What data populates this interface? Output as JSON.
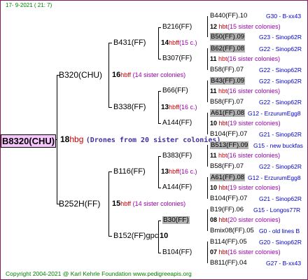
{
  "header": {
    "date": "17-  9-2021 ( 21:  7)"
  },
  "root": {
    "name": "B8320(CHU)",
    "year": "18",
    "hb": "hbg",
    "drones": "(Drones from 20 sister colonies)"
  },
  "g1": [
    {
      "name": "B320(CHU)",
      "year": "16",
      "hb": "hbff",
      "sis": "(14 sister colonies)"
    },
    {
      "name": "B252H(FF)",
      "year": "15",
      "hb": "hbff",
      "sis": "(14 sister colonies)"
    }
  ],
  "g2": [
    {
      "name": "B431(FF)",
      "year": "14",
      "hb": "hbff",
      "sis": "(15 c.)"
    },
    {
      "name": "B338(FF)",
      "year": "13",
      "hb": "hbff",
      "sis": "(16 c.)"
    },
    {
      "name": "B116(FF)",
      "year": "13",
      "hb": "hbff",
      "sis": "(16 c.)"
    },
    {
      "name": "B152(FF)gpc",
      "year": "10"
    }
  ],
  "g3": [
    {
      "name": "B216(FF)",
      "year": "12",
      "hb": "hbt",
      "sis": "(15 sister colonies)"
    },
    {
      "name": "B307(FF)",
      "year": "11",
      "hb": "hbt",
      "sis": "(16 sister colonies)"
    },
    {
      "name": "B66(FF)",
      "year": "11",
      "hb": "hbt",
      "sis": "(16 sister colonies)"
    },
    {
      "name": "A144(FF)",
      "year": "10",
      "hb": "hbt",
      "sis": "(19 sister colonies)"
    },
    {
      "name": "B383(FF)",
      "year": "11",
      "hb": "hbt",
      "sis": "(16 sister colonies)"
    },
    {
      "name": "A144(FF)",
      "year": "10",
      "hb": "hbt",
      "sis": "(19 sister colonies)"
    },
    {
      "name": "B30(FF)",
      "year": "08",
      "hb": "hbt",
      "sis": "(20 sister colonies)"
    },
    {
      "name": "B104(FF)",
      "year": "07",
      "hb": "hbt",
      "sis": "(16 sister colonies)"
    }
  ],
  "leaves": [
    {
      "name": "B440(FF).10",
      "lineage": "G30 - B-xx43"
    },
    {
      "name": "B50(FF).09",
      "lineage": "G23 - Sinop62R"
    },
    {
      "name": "B62(FF).08",
      "lineage": "G22 - Sinop62R"
    },
    {
      "name": "B58(FF).07",
      "lineage": "G22 - Sinop62R"
    },
    {
      "name": "B43(FF).09",
      "lineage": "G22 - Sinop62R"
    },
    {
      "name": "B58(FF).07",
      "lineage": "G22 - Sinop62R"
    },
    {
      "name": "A61(FF).08",
      "lineage": "G12 - ErzurumEgg8"
    },
    {
      "name": "B104(FF).07",
      "lineage": "G21 - Sinop62R"
    },
    {
      "name": "B513(FF).09",
      "lineage": "G15 - new buckfas"
    },
    {
      "name": "B58(FF).07",
      "lineage": "G22 - Sinop62R"
    },
    {
      "name": "A61(FF).08",
      "lineage": "G12 - ErzurumEgg8"
    },
    {
      "name": "B104(FF).07",
      "lineage": "G21 - Sinop62R"
    },
    {
      "name": "B19(FF).06",
      "lineage": "G15 - Longos77R"
    },
    {
      "name": "Bmix08(FF).05",
      "lineage": "G0 - old lines B"
    },
    {
      "name": "B114(FF).05",
      "lineage": "G20 - Sinop62R"
    },
    {
      "name": "B811(FF).04",
      "lineage": "G27 - B-xx43"
    }
  ],
  "footer": {
    "text": "Copyright 2004-2021 @ Karl Kehrle Foundation    www.pedigreeapis.org"
  }
}
